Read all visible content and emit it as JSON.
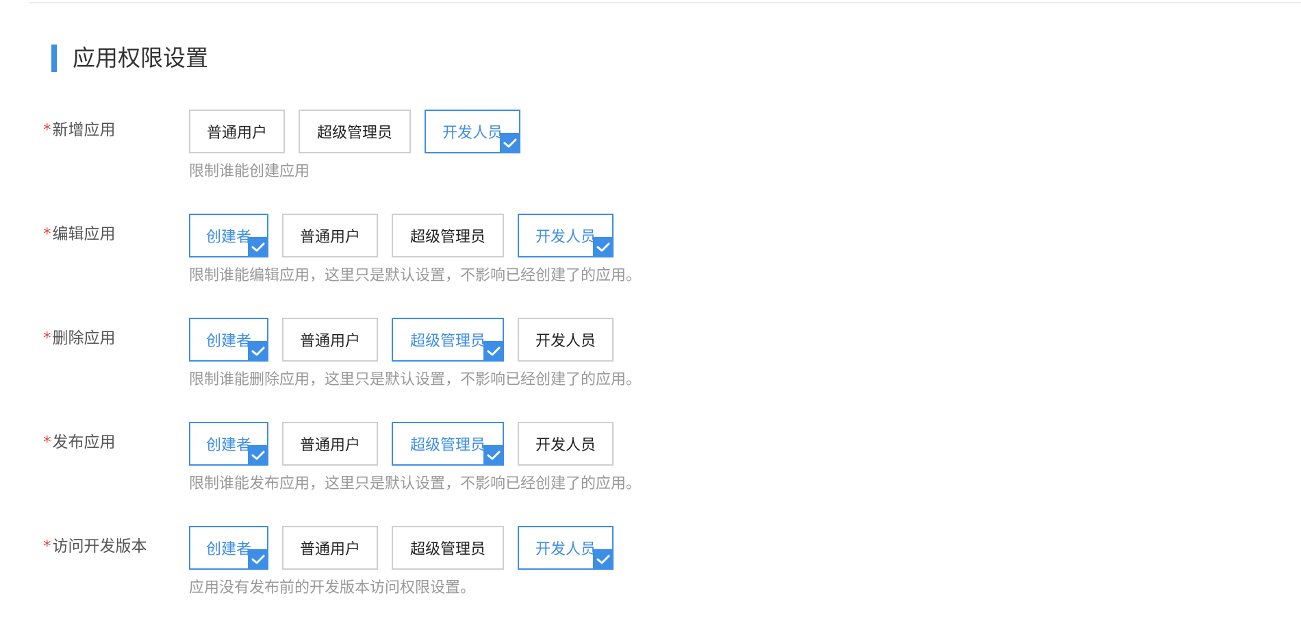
{
  "section": {
    "title": "应用权限设置"
  },
  "rows": [
    {
      "label": "新增应用",
      "required_mark": "*",
      "hint": "限制谁能创建应用",
      "options": [
        {
          "label": "普通用户",
          "selected": false
        },
        {
          "label": "超级管理员",
          "selected": false
        },
        {
          "label": "开发人员",
          "selected": true
        }
      ]
    },
    {
      "label": "编辑应用",
      "required_mark": "*",
      "hint": "限制谁能编辑应用，这里只是默认设置，不影响已经创建了的应用。",
      "options": [
        {
          "label": "创建者",
          "selected": true
        },
        {
          "label": "普通用户",
          "selected": false
        },
        {
          "label": "超级管理员",
          "selected": false
        },
        {
          "label": "开发人员",
          "selected": true
        }
      ]
    },
    {
      "label": "删除应用",
      "required_mark": "*",
      "hint": "限制谁能删除应用，这里只是默认设置，不影响已经创建了的应用。",
      "options": [
        {
          "label": "创建者",
          "selected": true
        },
        {
          "label": "普通用户",
          "selected": false
        },
        {
          "label": "超级管理员",
          "selected": true
        },
        {
          "label": "开发人员",
          "selected": false
        }
      ]
    },
    {
      "label": "发布应用",
      "required_mark": "*",
      "hint": "限制谁能发布应用，这里只是默认设置，不影响已经创建了的应用。",
      "options": [
        {
          "label": "创建者",
          "selected": true
        },
        {
          "label": "普通用户",
          "selected": false
        },
        {
          "label": "超级管理员",
          "selected": true
        },
        {
          "label": "开发人员",
          "selected": false
        }
      ]
    },
    {
      "label": "访问开发版本",
      "required_mark": "*",
      "hint": "应用没有发布前的开发版本访问权限设置。",
      "options": [
        {
          "label": "创建者",
          "selected": true
        },
        {
          "label": "普通用户",
          "selected": false
        },
        {
          "label": "超级管理员",
          "selected": false
        },
        {
          "label": "开发人员",
          "selected": true
        }
      ]
    }
  ],
  "colors": {
    "accent": "#3d8ee6",
    "required": "#e2453d",
    "hint": "#999999",
    "border": "#cfcfcf"
  },
  "icons": {
    "selected_marker": "checkmark-icon",
    "section_marker": "section-accent-bar"
  }
}
